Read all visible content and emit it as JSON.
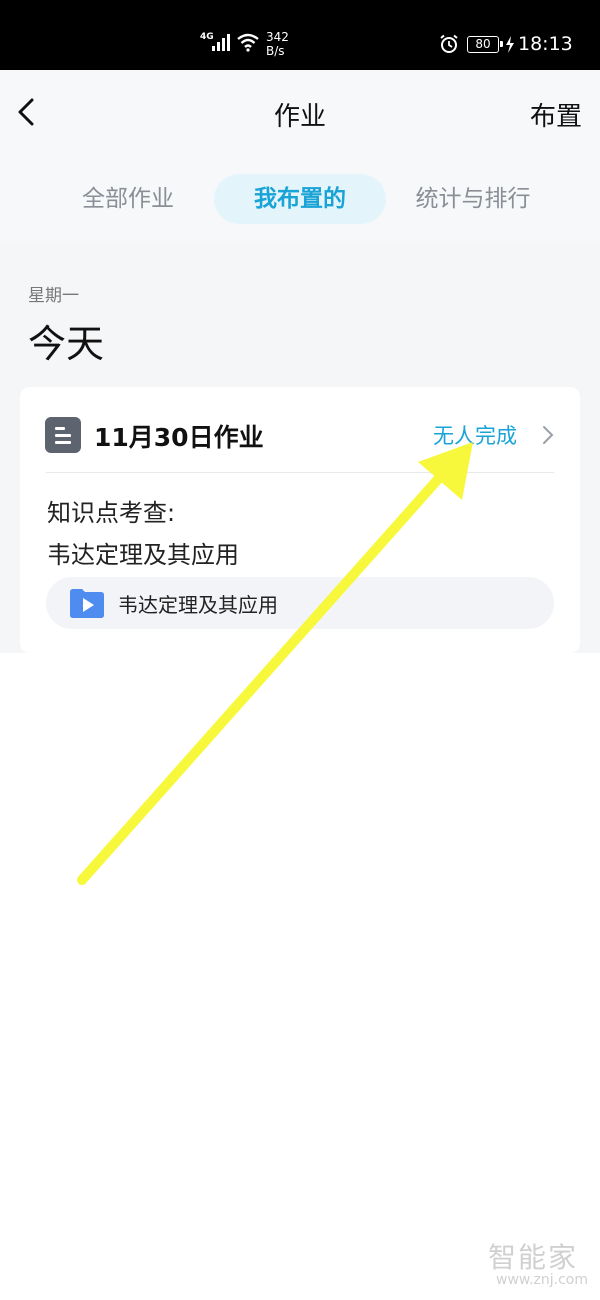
{
  "status_bar": {
    "network": "4G",
    "speed_value": "342",
    "speed_unit": "B/s",
    "battery": "80",
    "time": "18:13"
  },
  "header": {
    "title": "作业",
    "assign_label": "布置"
  },
  "tabs": [
    {
      "label": "全部作业",
      "active": false
    },
    {
      "label": "我布置的",
      "active": true
    },
    {
      "label": "统计与排行",
      "active": false
    }
  ],
  "section": {
    "weekday": "星期一",
    "day_title": "今天"
  },
  "card": {
    "title": "11月30日作业",
    "status": "无人完成",
    "knowledge_label": "知识点考查:",
    "knowledge_value": "韦达定理及其应用",
    "resource_label": "韦达定理及其应用"
  },
  "watermark": {
    "logo": "智能家",
    "url": "www.znj.com"
  },
  "colors": {
    "accent": "#1aa3d6",
    "annotation": "#f7f73c"
  }
}
